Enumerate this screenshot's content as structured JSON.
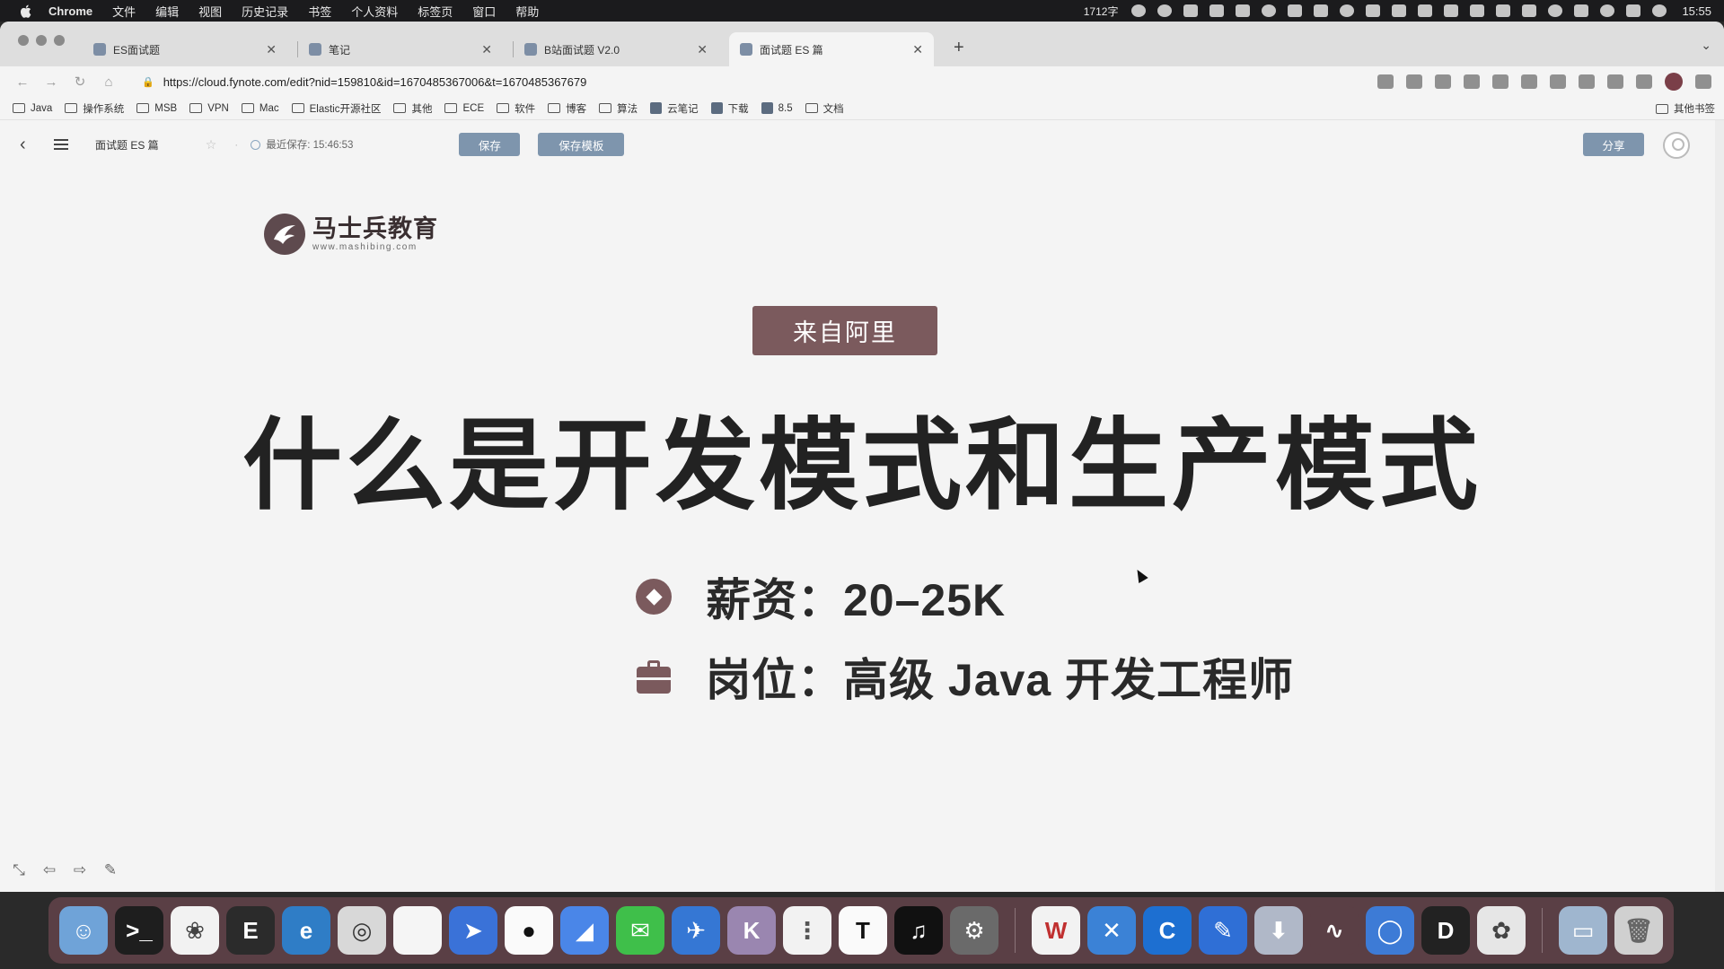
{
  "menubar": {
    "app": "Chrome",
    "items": [
      "文件",
      "编辑",
      "视图",
      "历史记录",
      "书签",
      "个人资料",
      "标签页",
      "窗口",
      "帮助"
    ],
    "word_count": "1712字",
    "time": "15:55"
  },
  "tabs": [
    {
      "title": "ES面试题"
    },
    {
      "title": "笔记"
    },
    {
      "title": "B站面试题 V2.0"
    },
    {
      "title": "面试题 ES 篇"
    }
  ],
  "url": "https://cloud.fynote.com/edit?nid=159810&id=1670485367006&t=1670485367679",
  "bookmarks": [
    "Java",
    "操作系统",
    "MSB",
    "VPN",
    "Mac",
    "Elastic开源社区",
    "其他",
    "ECE",
    "软件",
    "博客",
    "算法",
    "云笔记",
    "下载",
    "8.5",
    "文档"
  ],
  "bookmarks_other": "其他书签",
  "app_header": {
    "doc_title": "面试题 ES 篇",
    "last_saved": "最近保存: 15:46:53",
    "save": "保存",
    "save_template": "保存模板",
    "share": "分享"
  },
  "slide": {
    "logo_name": "马士兵教育",
    "logo_url": "www.mashibing.com",
    "tag": "来自阿里",
    "headline": "什么是开发模式和生产模式",
    "salary": "薪资：20–25K",
    "position": "岗位：高级 Java 开发工程师"
  },
  "dock_apps": [
    "finder-icon",
    "terminal-icon",
    "qq-penguin-icon",
    "typora-icon",
    "edge-icon",
    "safari-icon",
    "notes-icon",
    "feishu-icon",
    "qq-icon",
    "wps-icon",
    "wechat-icon",
    "tool-icon",
    "code-icon",
    "list-icon",
    "typora-t-icon",
    "audio-icon",
    "settings-icon",
    "wps-w-icon",
    "x-icon",
    "c-icon",
    "pen-icon",
    "download-icon",
    "wave-icon",
    "circle-icon",
    "d-icon",
    "game-icon",
    "folder-icon",
    "trash-icon"
  ],
  "colors": {
    "accent": "#7b5a5d",
    "button": "#7e95ad",
    "dock": "#5a3f45"
  }
}
